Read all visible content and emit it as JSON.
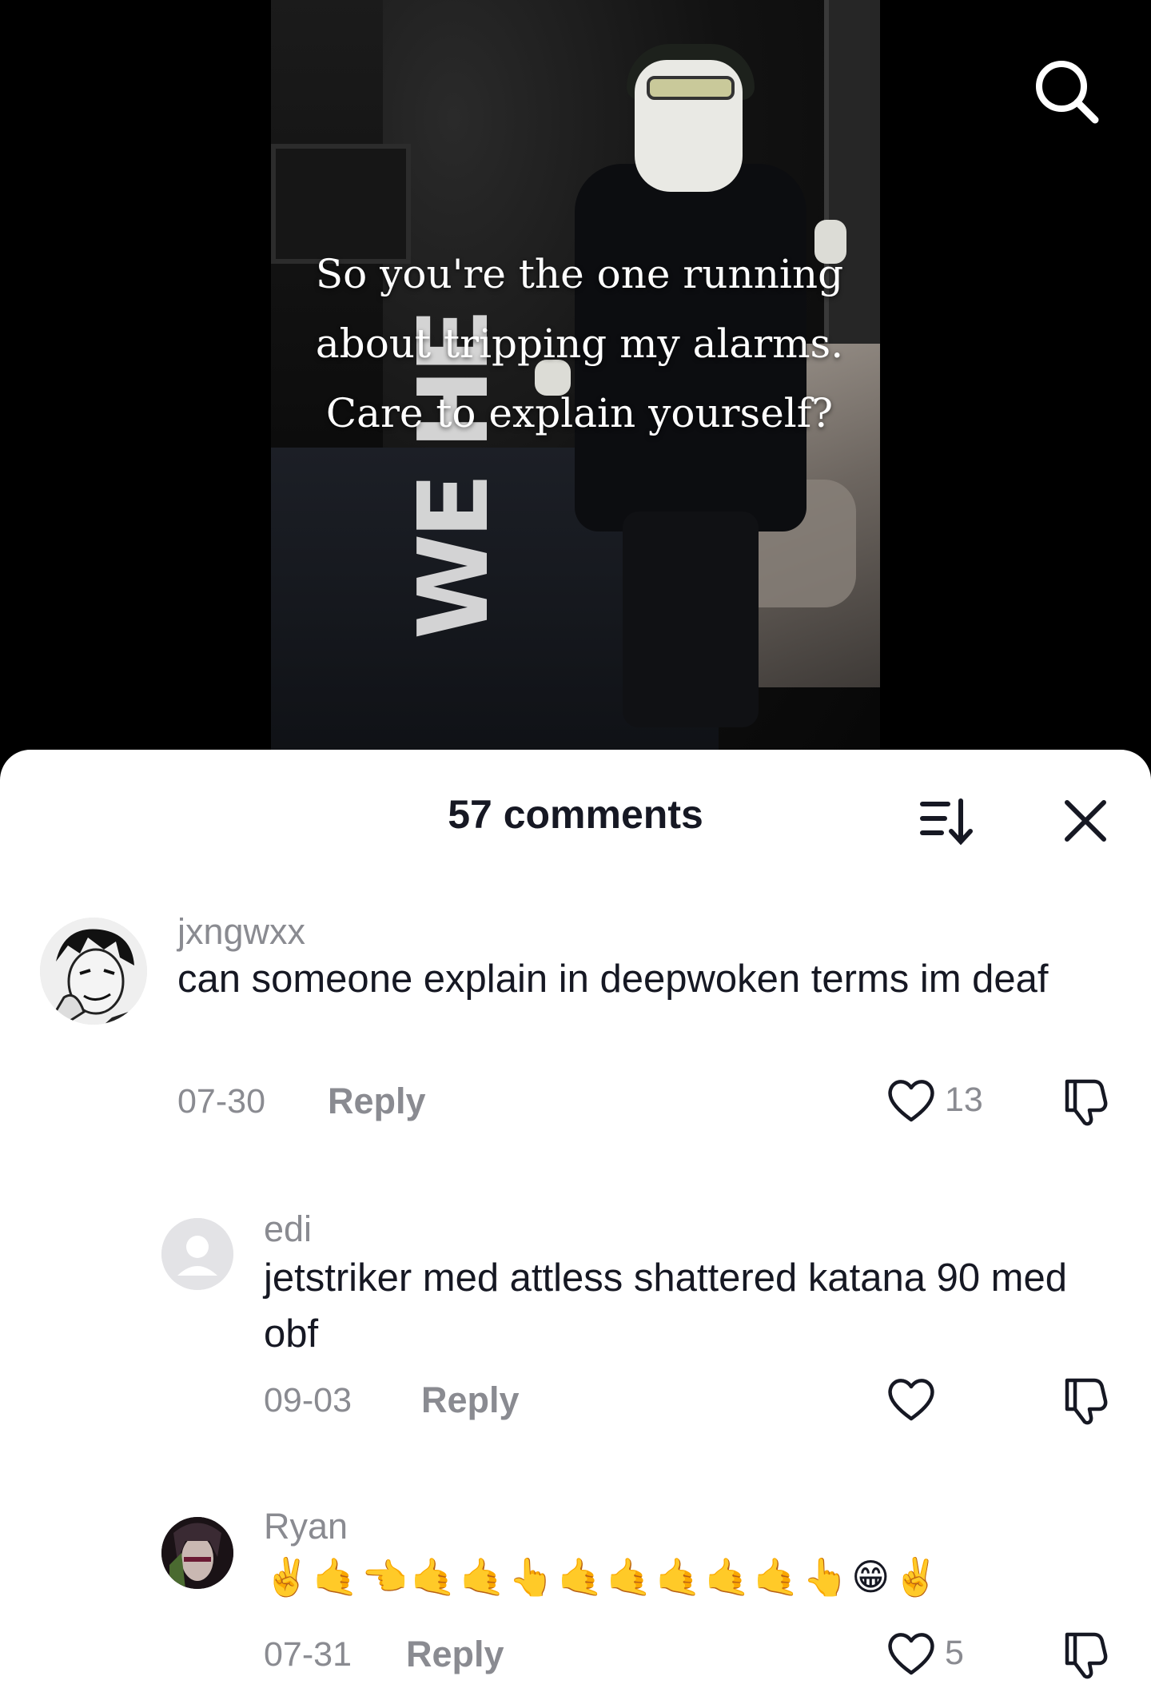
{
  "video": {
    "caption": "So you're the one running about tripping my alarms. Care to explain yourself?",
    "rug_text": "WE HE"
  },
  "comments_sheet": {
    "title": "57 comments",
    "comments": [
      {
        "username": "jxngwxx",
        "text": "can someone explain in deepwoken terms im deaf",
        "date": "07-30",
        "reply_label": "Reply",
        "likes": "13"
      },
      {
        "username": "edi",
        "text": "jetstriker med attless shattered katana 90 med obf",
        "date": "09-03",
        "reply_label": "Reply",
        "likes": ""
      },
      {
        "username": "Ryan",
        "text": "✌️🤙👈🤙🤙👆🤙🤙🤙🤙🤙👆😁✌️",
        "date": "07-31",
        "reply_label": "Reply",
        "likes": "5"
      }
    ]
  },
  "colors": {
    "text_primary": "#161823",
    "text_secondary": "#8a8b91",
    "sheet_bg": "#ffffff",
    "video_bg": "#000000"
  },
  "icons": [
    "search-icon",
    "sort-icon",
    "close-icon",
    "heart-icon",
    "dislike-icon"
  ]
}
